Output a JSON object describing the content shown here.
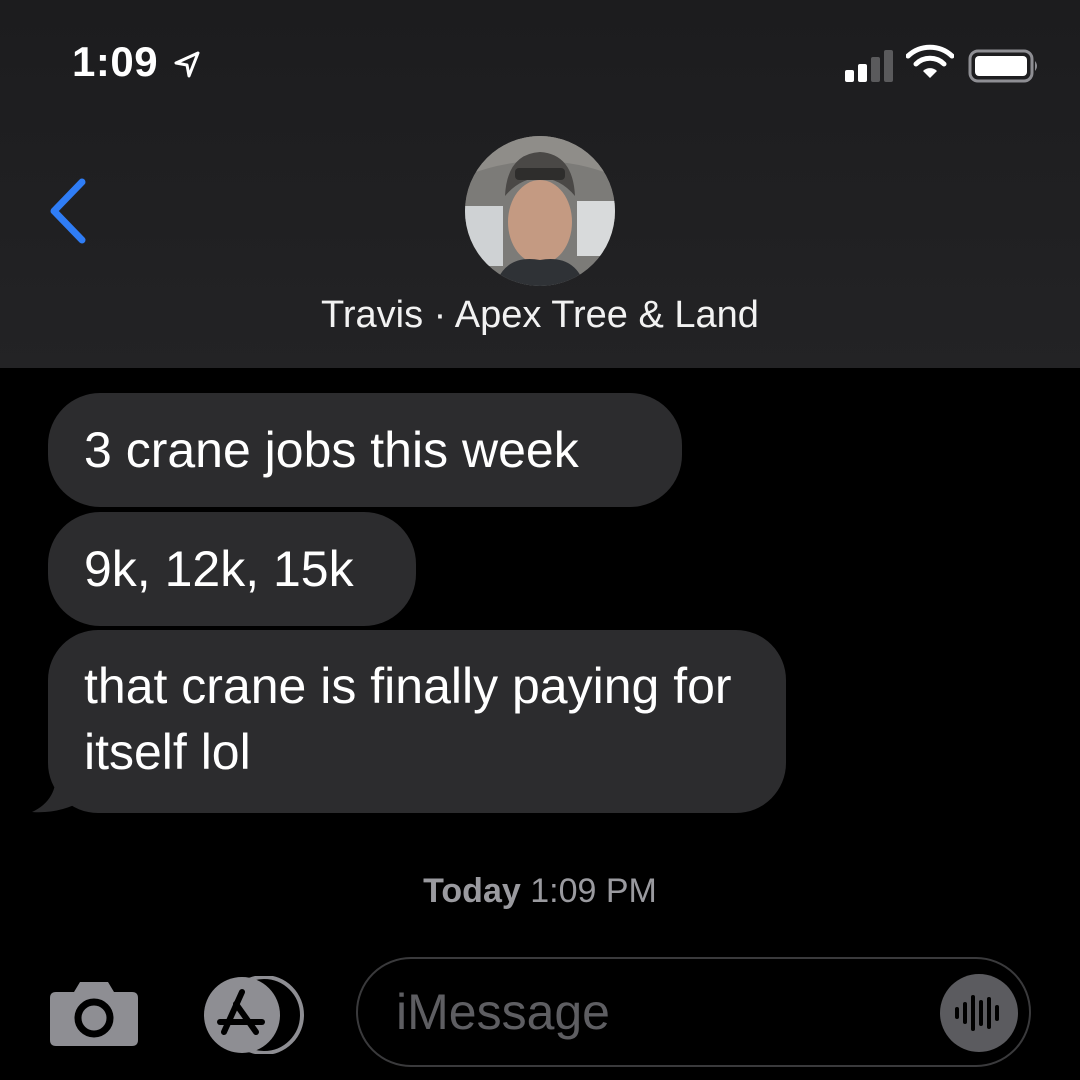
{
  "status_bar": {
    "time": "1:09",
    "icons": [
      "location-arrow-icon",
      "signal-icon",
      "wifi-icon",
      "battery-icon"
    ]
  },
  "header": {
    "back_icon": "chevron-left-icon",
    "contact_name": "Travis · Apex Tree & Land"
  },
  "messages": [
    {
      "text": "3 crane jobs this week",
      "direction": "incoming"
    },
    {
      "text": "9k, 12k, 15k",
      "direction": "incoming"
    },
    {
      "text": "that crane is finally paying for itself lol",
      "direction": "incoming"
    }
  ],
  "timestamp": {
    "day": "Today",
    "time": "1:09 PM"
  },
  "input_bar": {
    "placeholder": "iMessage",
    "icons": [
      "camera-icon",
      "app-store-icon",
      "audio-waveform-icon"
    ]
  },
  "colors": {
    "accent": "#2f7df6",
    "bubble_incoming": "#2c2c2e",
    "header_bg": "#1f1f21",
    "background": "#000000"
  }
}
